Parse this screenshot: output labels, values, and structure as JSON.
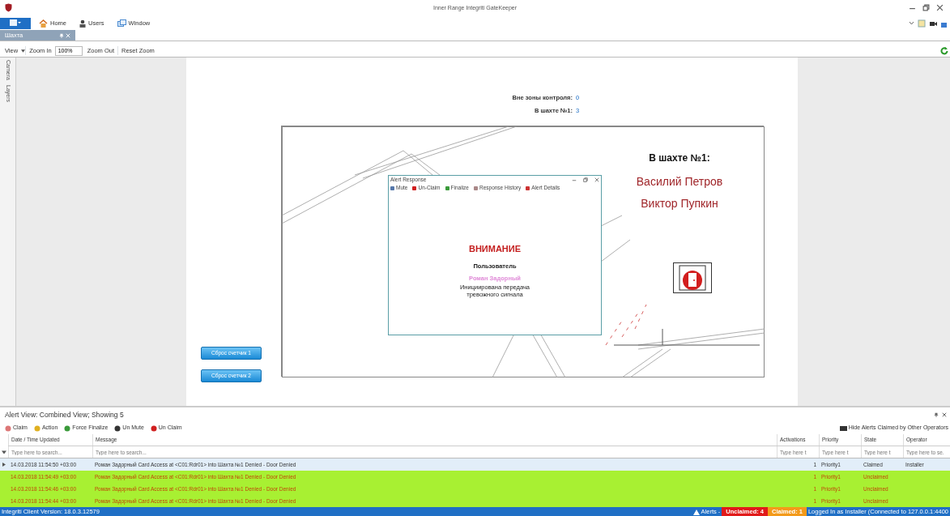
{
  "window": {
    "title": "Inner Range Integriti GateKeeper"
  },
  "ribbon_tabs": [
    {
      "label": "Home"
    },
    {
      "label": "Users"
    },
    {
      "label": "Window"
    }
  ],
  "document_tab": {
    "label": "Шахта"
  },
  "view_toolbar": {
    "view": "View",
    "zoom_in": "Zoom In",
    "zoom_value": "100%",
    "zoom_out": "Zoom Out",
    "reset_zoom": "Reset Zoom"
  },
  "side_tabs": [
    "Camera",
    "Layers"
  ],
  "counters": [
    {
      "label": "Вне зоны контроля:",
      "value": "0"
    },
    {
      "label": "В шахте №1:",
      "value": "3"
    }
  ],
  "plan": {
    "heading": "В шахте №1:",
    "people": [
      "Василий Петров",
      "Виктор Пупкин"
    ]
  },
  "reset_buttons": [
    "Сброс счетчик 1",
    "Сброс счетчик 2"
  ],
  "alert_dialog": {
    "title": "Alert Response",
    "toolbar": [
      "Mute",
      "Un-Claim",
      "Finalize",
      "Response History",
      "Alert Details"
    ],
    "heading": "ВНИМАНИЕ",
    "label": "Пользователь",
    "user": "Роман Задорный",
    "message": "Инициирована передача тревожного сигнала"
  },
  "alert_view": {
    "title": "Alert View: Combined View; Showing 5",
    "toolbar": [
      "Claim",
      "Action",
      "Force Finalize",
      "Un Mute",
      "Un Claim"
    ],
    "hide_toggle": "Hide Alerts Claimed by Other Operators",
    "columns": [
      {
        "label": "Date / Time Updated",
        "placeholder": "Type here to search..."
      },
      {
        "label": "Message",
        "placeholder": "Type here to search..."
      },
      {
        "label": "Activations",
        "placeholder": "Type here t"
      },
      {
        "label": "Priority",
        "placeholder": "Type here t"
      },
      {
        "label": "State",
        "placeholder": "Type here t"
      },
      {
        "label": "Operator",
        "placeholder": "Type here to se."
      }
    ],
    "rows": [
      {
        "kind": "claimed",
        "selected": true,
        "cells": [
          "14.03.2018 11:54:50 +03:00",
          "Роман Задорный Card Access at <C01:Rdr01> into Шахта №1 Denied - Door Denied",
          "1",
          "Priority1",
          "Claimed",
          "Installer"
        ]
      },
      {
        "kind": "unclaimed",
        "selected": false,
        "cells": [
          "14.03.2018 11:54:49 +03:00",
          "Роман Задорный Card Access at <C01:Rdr01> into Шахта №1 Denied - Door Denied",
          "1",
          "Priority1",
          "Unclaimed",
          ""
        ]
      },
      {
        "kind": "unclaimed",
        "selected": false,
        "cells": [
          "14.03.2018 11:54:46 +03:00",
          "Роман Задорный Card Access at <C01:Rdr01> into Шахта №1 Denied - Door Denied",
          "1",
          "Priority1",
          "Unclaimed",
          ""
        ]
      },
      {
        "kind": "unclaimed",
        "selected": false,
        "cells": [
          "14.03.2018 11:54:44 +03:00",
          "Роман Задорный Card Access at <C01:Rdr01> into Шахта №1 Denied - Door Denied",
          "1",
          "Priority1",
          "Unclaimed",
          ""
        ]
      }
    ]
  },
  "status_bar": {
    "version": "Integriti Client Version: 18.0.3.12579",
    "alerts": "Alerts -",
    "unclaimed": "Unclaimed: 4",
    "claimed": "Claimed: 1",
    "login": "Logged In as Installer (Connected to 127.0.0.1:4400"
  }
}
